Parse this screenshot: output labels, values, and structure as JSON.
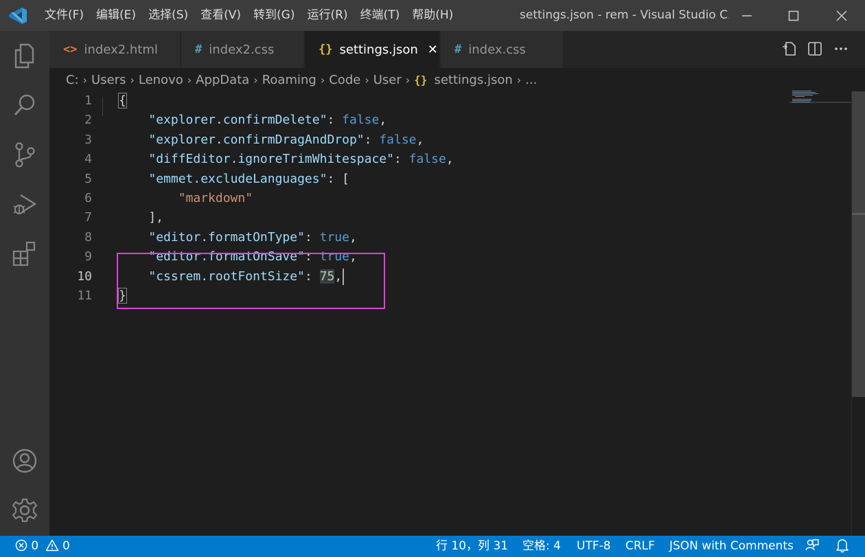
{
  "titlebar": {
    "menus": [
      "文件(F)",
      "编辑(E)",
      "选择(S)",
      "查看(V)",
      "转到(G)",
      "运行(R)",
      "终端(T)",
      "帮助(H)"
    ],
    "window_title": "settings.json - rem - Visual Studio C..."
  },
  "tabs": [
    {
      "icon": "<>",
      "label": "index2.html",
      "active": false
    },
    {
      "icon": "#",
      "label": "index2.css",
      "active": false
    },
    {
      "icon": "{}",
      "label": "settings.json",
      "active": true,
      "close": "✕"
    },
    {
      "icon": "#",
      "label": "index.css",
      "active": false
    }
  ],
  "breadcrumb": {
    "items": [
      "C:",
      "Users",
      "Lenovo",
      "AppData",
      "Roaming",
      "Code",
      "User"
    ],
    "file_icon": "{}",
    "file": "settings.json",
    "more": "..."
  },
  "editor": {
    "lines": [
      {
        "num": "1",
        "tokens": [
          {
            "t": "{",
            "c": "p"
          }
        ]
      },
      {
        "num": "2",
        "tokens": [
          {
            "t": "    ",
            "c": "p"
          },
          {
            "t": "\"explorer.confirmDelete\"",
            "c": "k"
          },
          {
            "t": ": ",
            "c": "p"
          },
          {
            "t": "false",
            "c": "b"
          },
          {
            "t": ",",
            "c": "p"
          }
        ]
      },
      {
        "num": "3",
        "tokens": [
          {
            "t": "    ",
            "c": "p"
          },
          {
            "t": "\"explorer.confirmDragAndDrop\"",
            "c": "k"
          },
          {
            "t": ": ",
            "c": "p"
          },
          {
            "t": "false",
            "c": "b"
          },
          {
            "t": ",",
            "c": "p"
          }
        ]
      },
      {
        "num": "4",
        "tokens": [
          {
            "t": "    ",
            "c": "p"
          },
          {
            "t": "\"diffEditor.ignoreTrimWhitespace\"",
            "c": "k"
          },
          {
            "t": ": ",
            "c": "p"
          },
          {
            "t": "false",
            "c": "b"
          },
          {
            "t": ",",
            "c": "p"
          }
        ]
      },
      {
        "num": "5",
        "tokens": [
          {
            "t": "    ",
            "c": "p"
          },
          {
            "t": "\"emmet.excludeLanguages\"",
            "c": "k"
          },
          {
            "t": ": [",
            "c": "p"
          }
        ]
      },
      {
        "num": "6",
        "tokens": [
          {
            "t": "        ",
            "c": "p"
          },
          {
            "t": "\"markdown\"",
            "c": "s"
          }
        ]
      },
      {
        "num": "7",
        "tokens": [
          {
            "t": "    ],",
            "c": "p"
          }
        ]
      },
      {
        "num": "8",
        "tokens": [
          {
            "t": "    ",
            "c": "p"
          },
          {
            "t": "\"editor.formatOnType\"",
            "c": "k"
          },
          {
            "t": ": ",
            "c": "p"
          },
          {
            "t": "true",
            "c": "b"
          },
          {
            "t": ",",
            "c": "p"
          }
        ]
      },
      {
        "num": "9",
        "tokens": [
          {
            "t": "    ",
            "c": "p"
          },
          {
            "t": "\"editor.formatOnSave\"",
            "c": "k"
          },
          {
            "t": ": ",
            "c": "p"
          },
          {
            "t": "true",
            "c": "b"
          },
          {
            "t": ",",
            "c": "p"
          }
        ]
      },
      {
        "num": "10",
        "tokens": [
          {
            "t": "    ",
            "c": "p"
          },
          {
            "t": "\"cssrem.rootFontSize\"",
            "c": "k"
          },
          {
            "t": ": ",
            "c": "p"
          },
          {
            "t": "75",
            "c": "n"
          },
          {
            "t": ",",
            "c": "p"
          }
        ],
        "current": true
      },
      {
        "num": "11",
        "tokens": [
          {
            "t": "}",
            "c": "p"
          }
        ]
      }
    ]
  },
  "statusbar": {
    "errors": "0",
    "warnings": "0",
    "position": "行 10，列 31",
    "indent": "空格: 4",
    "encoding": "UTF-8",
    "eol": "CRLF",
    "language": "JSON with Comments"
  },
  "colors": {
    "accent": "#007acc",
    "highlight_box": "#e040e0",
    "vscode_blue": "#2f9bd9"
  }
}
